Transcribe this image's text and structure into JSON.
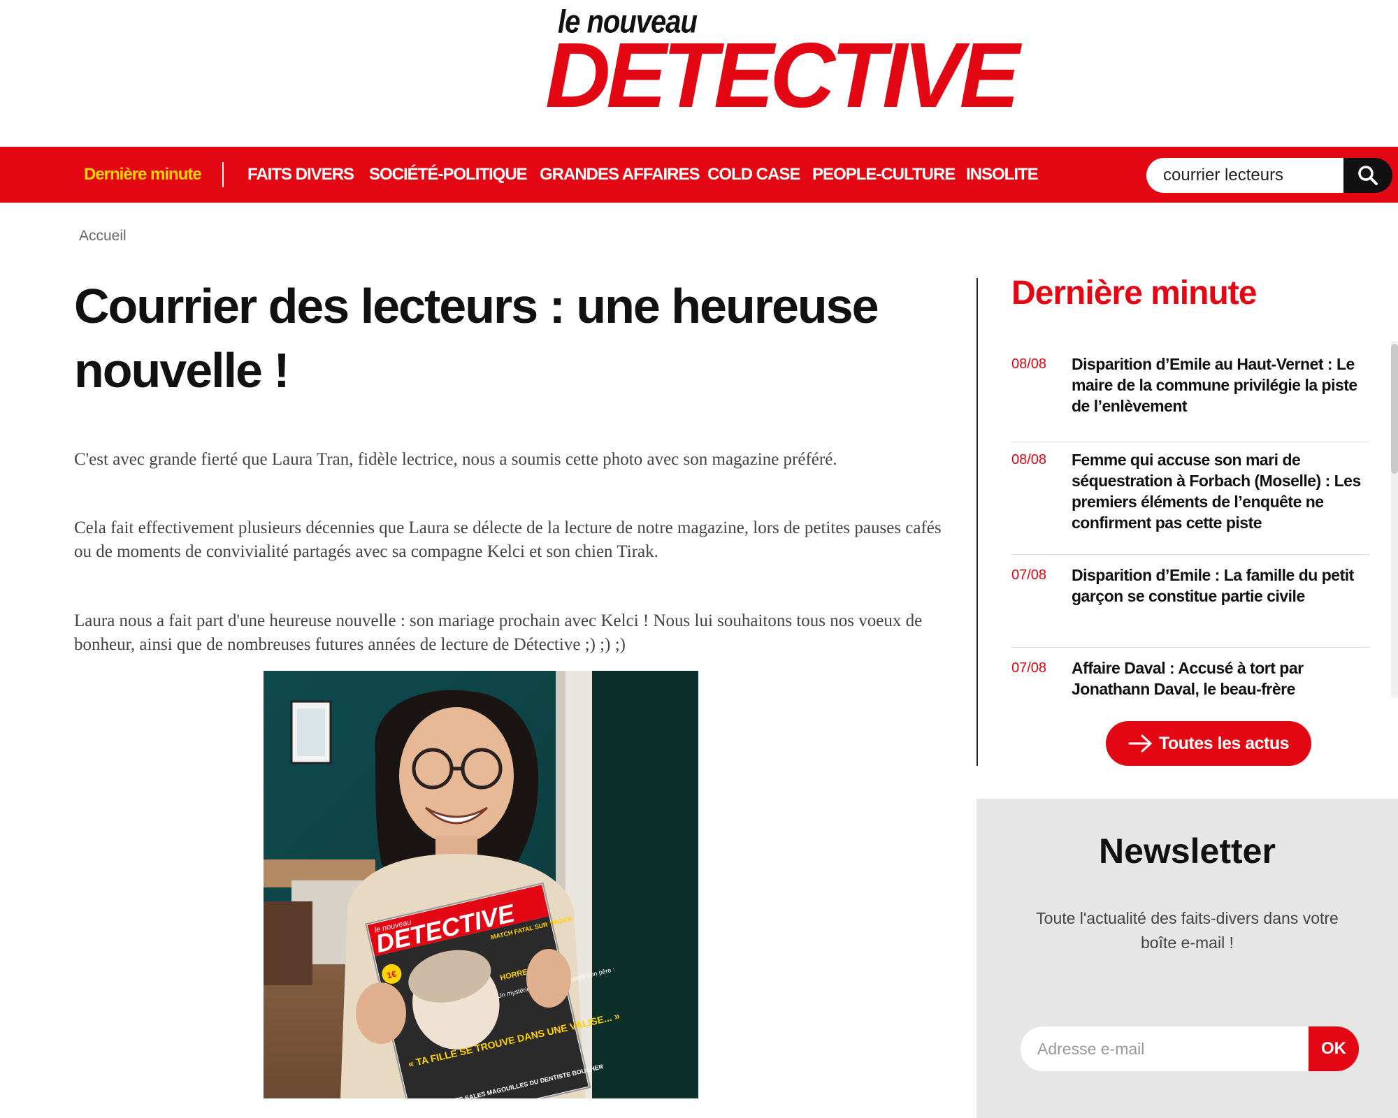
{
  "logo": {
    "small": "le nouveau",
    "big": "DETECTIVE"
  },
  "nav": {
    "items": [
      {
        "label": "Dernière minute"
      },
      {
        "label": "FAITS DIVERS"
      },
      {
        "label": "SOCIÉTÉ-POLITIQUE"
      },
      {
        "label": "GRANDES AFFAIRES"
      },
      {
        "label": "COLD CASE"
      },
      {
        "label": "PEOPLE-CULTURE"
      },
      {
        "label": "INSOLITE"
      }
    ],
    "search_value": "courrier lecteurs"
  },
  "breadcrumb": "Accueil",
  "article": {
    "title": "Courrier des lecteurs : une heureuse nouvelle !",
    "paragraphs": [
      "C'est avec grande fierté que Laura Tran, fidèle lectrice, nous a soumis cette photo avec son magazine préféré.",
      "Cela fait effectivement plusieurs décennies que Laura se délecte de la lecture de notre magazine, lors de petites pauses cafés ou de moments de convivialité partagés avec sa compagne Kelci et son chien Tirak.",
      "Laura nous a fait part d'une heureuse nouvelle : son mariage prochain avec Kelci ! Nous lui souhaitons tous nos voeux de bonheur, ainsi que de nombreuses futures années de lecture de Détective ;) ;) ;)"
    ],
    "photo": {
      "magazine_brand_small": "le nouveau",
      "magazine_brand": "DETECTIVE",
      "cover_price": "1€",
      "cover_headline_top": "MATCH FATAL SUR TINDER",
      "cover_tag": "HORREUR",
      "cover_teaser": "Un mystérieux corbeau a appelé son père :",
      "cover_headline": "« TA FILLE SE TROUVE DANS UNE VALISE... »",
      "cover_bottom": "LES SALES MAGOUILLES DU DENTISTE BOUCHER"
    }
  },
  "sidebar": {
    "title": "Dernière minute",
    "news": [
      {
        "date": "08/08",
        "text": "Disparition d’Emile au Haut-Vernet : Le maire de la commune privilégie la piste de l’enlèvement"
      },
      {
        "date": "08/08",
        "text": "Femme qui accuse son mari de séquestration à Forbach (Moselle) : Les premiers éléments de l’enquête ne confirment pas cette piste"
      },
      {
        "date": "07/08",
        "text": "Disparition d’Emile : La famille du petit garçon se constitue partie civile"
      },
      {
        "date": "07/08",
        "text": "Affaire Daval : Accusé à tort par Jonathann Daval, le beau-frère"
      }
    ],
    "all_news_label": "Toutes les actus"
  },
  "newsletter": {
    "title": "Newsletter",
    "text": "Toute l'actualité des faits-divers dans votre boîte e-mail !",
    "placeholder": "Adresse e-mail",
    "button": "OK"
  },
  "colors": {
    "brand_red": "#e30613",
    "highlight_yellow": "#ffd400"
  },
  "icons": {
    "search": "search-icon",
    "arrow": "arrow-right-icon"
  }
}
